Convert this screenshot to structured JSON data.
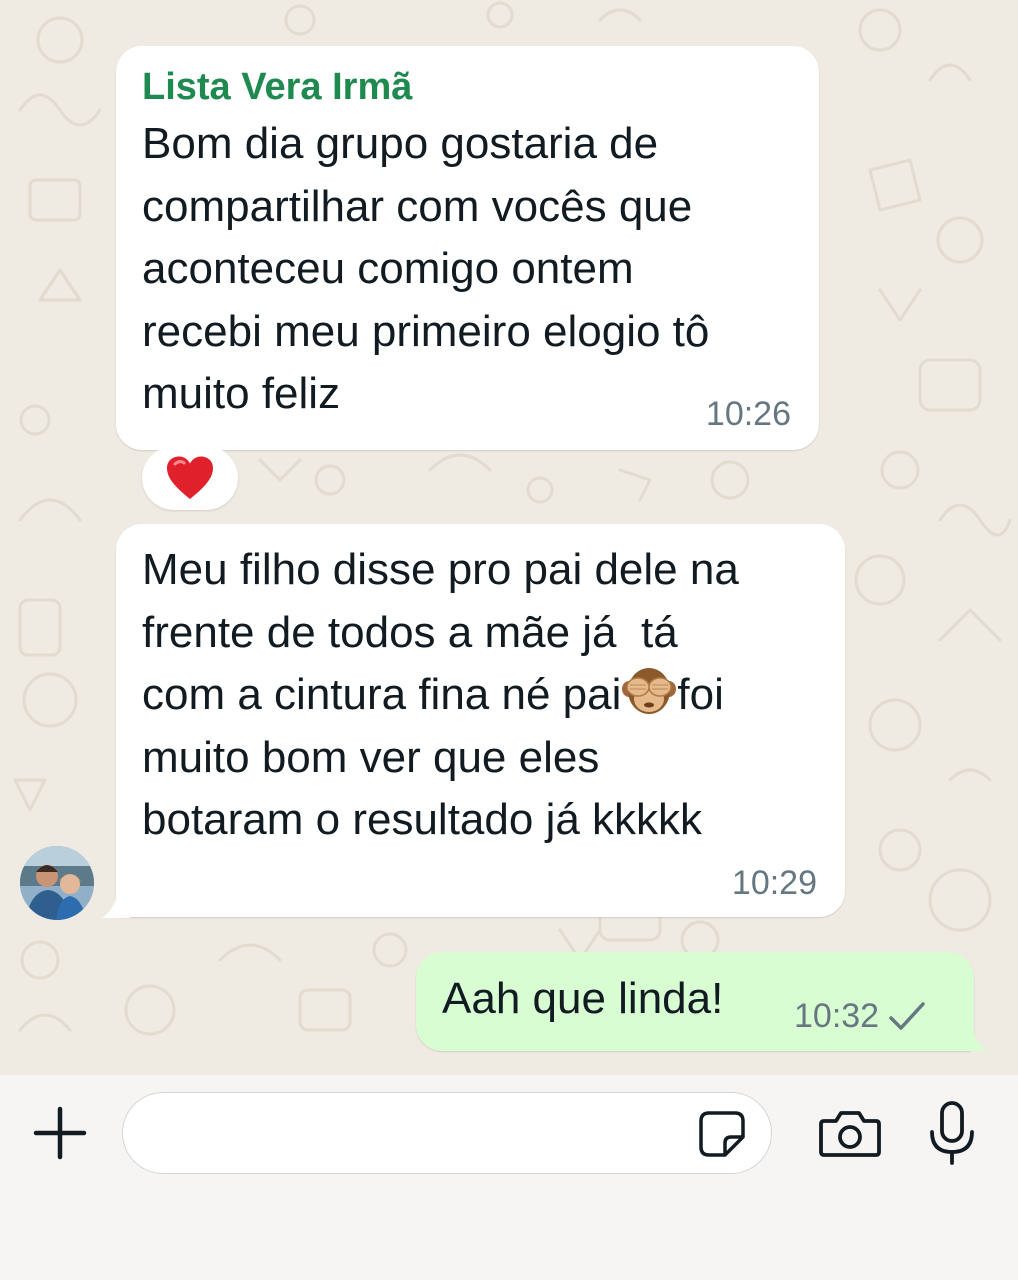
{
  "colors": {
    "chat_background": "#efeae2",
    "incoming_bubble": "#ffffff",
    "outgoing_bubble": "#d9fdd3",
    "sender_name": "#1f8a50",
    "timestamp": "#667781",
    "composer_background": "#f6f5f3"
  },
  "messages": [
    {
      "sender": "Lista Vera Irmã",
      "lines": [
        "Bom dia grupo gostaria de",
        "compartilhar com vocês que",
        "aconteceu comigo ontem",
        "recebi meu primeiro elogio tô",
        "muito feliz"
      ],
      "time": "10:26",
      "reaction": "❤️"
    },
    {
      "lines_before_emoji": [
        "Meu filho disse pro pai dele na",
        "frente de todos a mãe já  tá"
      ],
      "emoji_line_start": "com a cintura fina né pai",
      "emoji": "see-no-evil-monkey-emoji",
      "emoji_line_end": "foi",
      "lines_after_emoji": [
        "muito bom ver que eles",
        "botaram o resultado já kkkkk"
      ],
      "time": "10:29"
    },
    {
      "text": "Aah que linda!",
      "time": "10:32",
      "status_icon": "single-check-icon"
    }
  ],
  "composer": {
    "placeholder": "",
    "icons": [
      "plus-icon",
      "sticker-icon",
      "camera-icon",
      "microphone-icon"
    ]
  }
}
